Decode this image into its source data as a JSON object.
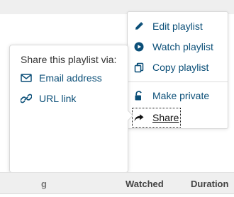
{
  "playlist_menu": {
    "items": [
      {
        "label": "Edit playlist",
        "icon": "pencil-icon"
      },
      {
        "label": "Watch playlist",
        "icon": "play-circle-icon"
      },
      {
        "label": "Copy playlist",
        "icon": "copy-icon"
      },
      {
        "label": "Make private",
        "icon": "lock-open-icon"
      },
      {
        "label": "Share",
        "icon": "share-icon"
      }
    ]
  },
  "share_popup": {
    "title": "Share this playlist via:",
    "options": [
      {
        "label": "Email address",
        "icon": "mail-icon"
      },
      {
        "label": "URL link",
        "icon": "link-icon"
      }
    ]
  },
  "table_header": {
    "columns": [
      "g",
      "Watched",
      "Duration"
    ]
  },
  "colors": {
    "link": "#0b4f78",
    "background": "#ffffff",
    "header_background": "#efefef",
    "border": "#d7d7d7",
    "text": "#333333"
  }
}
